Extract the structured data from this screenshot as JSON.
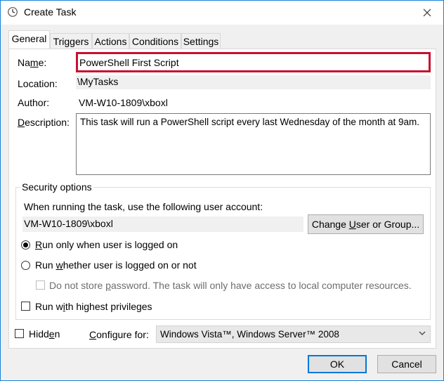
{
  "window": {
    "title": "Create Task"
  },
  "tabs": [
    {
      "label": "General"
    },
    {
      "label": "Triggers"
    },
    {
      "label": "Actions"
    },
    {
      "label": "Conditions"
    },
    {
      "label": "Settings"
    }
  ],
  "general": {
    "name_label_pre": "Na",
    "name_label_u": "m",
    "name_label_post": "e:",
    "name_value": "PowerShell First Script",
    "location_label": "Location:",
    "location_value": "\\MyTasks",
    "author_label": "Author:",
    "author_value": "VM-W10-1809\\xboxl",
    "description_label_u": "D",
    "description_label_post": "escription:",
    "description_value": "This task will run a PowerShell script every last Wednesday of the month at 9am."
  },
  "security": {
    "title": "Security options",
    "account_prompt": "When running the task, use the following user account:",
    "account_value": "VM-W10-1809\\xboxl",
    "change_button_pre": "Change ",
    "change_button_u": "U",
    "change_button_post": "ser or Group...",
    "radio_logged_on_u": "R",
    "radio_logged_on_post": "un only when user is logged on",
    "radio_logged_on_selected": true,
    "radio_whether_pre": "Run ",
    "radio_whether_u": "w",
    "radio_whether_post": "hether user is logged on or not",
    "no_store_pre": "Do not store ",
    "no_store_u": "p",
    "no_store_post": "assword.  The task will only have access to local computer resources.",
    "highest_pre": "Run w",
    "highest_u": "i",
    "highest_post": "th highest privileges"
  },
  "footer": {
    "hidden_pre": "Hidd",
    "hidden_u": "e",
    "hidden_post": "n",
    "configure_u": "C",
    "configure_post": "onfigure for:",
    "configure_value": "Windows Vista™, Windows Server™ 2008",
    "ok_label": "OK",
    "cancel_label": "Cancel"
  },
  "icons": {
    "app": "clock-icon",
    "close": "close-icon",
    "dropdown": "chevron-down-icon"
  },
  "colors": {
    "highlight_border": "#c8102e",
    "accent": "#0078d7"
  }
}
